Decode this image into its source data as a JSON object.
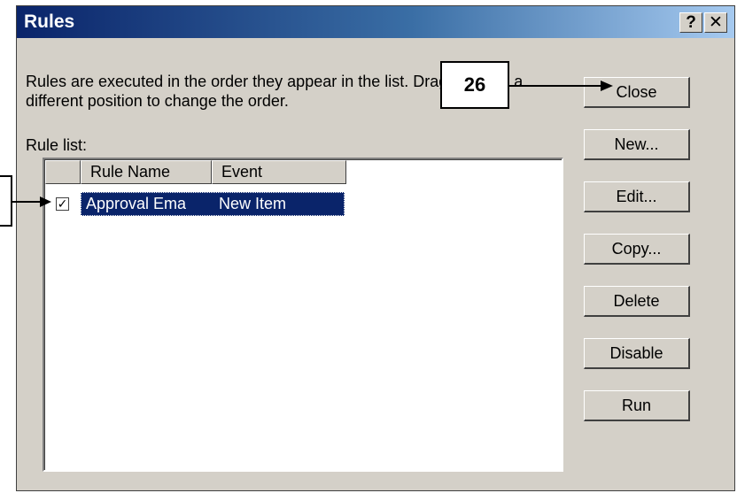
{
  "dialog": {
    "title": "Rules",
    "help_label": "?",
    "close_x_label": "✕"
  },
  "description": "Rules are executed in the order they appear in the list. Drag a rule to a different position to change the order.",
  "rule_list_label": "Rule list:",
  "columns": [
    "Rule Name",
    "Event"
  ],
  "rows": [
    {
      "checked": true,
      "rule_name": "Approval Ema",
      "event": "New Item"
    }
  ],
  "buttons": {
    "close": "Close",
    "new": "New...",
    "edit": "Edit...",
    "copy": "Copy...",
    "delete": "Delete",
    "disable": "Disable",
    "run": "Run"
  },
  "callout": {
    "number": "26"
  },
  "colors": {
    "titlebar_start": "#0a246a",
    "titlebar_end": "#a6caf0",
    "dialog_bg": "#d4d0c8",
    "selection": "#0a246a"
  }
}
